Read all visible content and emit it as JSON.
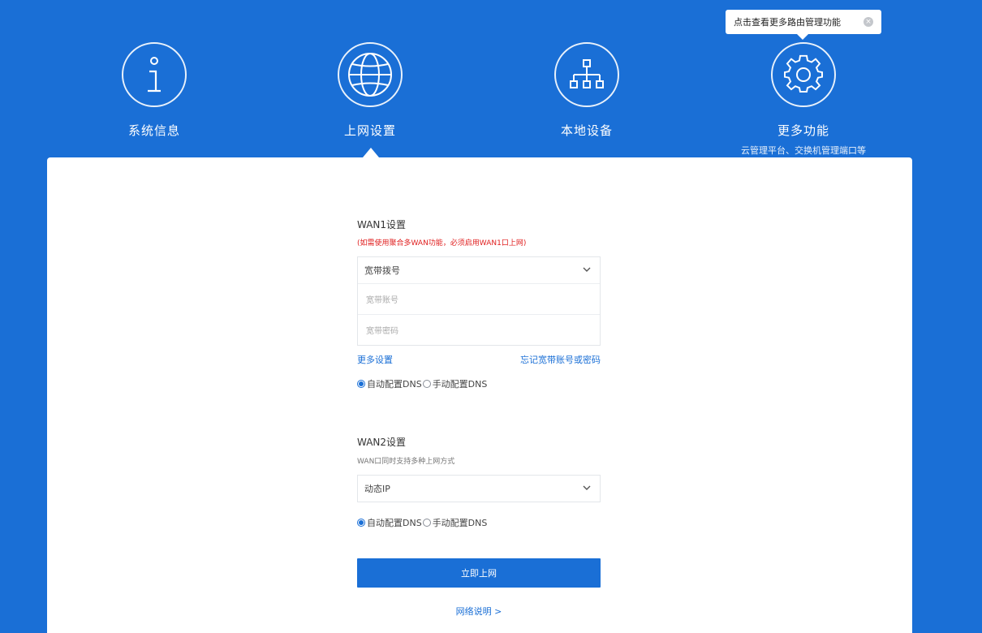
{
  "colors": {
    "brand": "#1a6fd6",
    "warning": "#e02020"
  },
  "nav": [
    {
      "id": "system-info",
      "label": "系统信息",
      "icon": "info-icon"
    },
    {
      "id": "internet-settings",
      "label": "上网设置",
      "icon": "globe-icon",
      "active": true
    },
    {
      "id": "local-devices",
      "label": "本地设备",
      "icon": "network-tree-icon"
    },
    {
      "id": "more-features",
      "label": "更多功能",
      "icon": "gear-icon",
      "sublabel": "云管理平台、交换机管理端口等"
    }
  ],
  "tooltip": {
    "text": "点击查看更多路由管理功能",
    "close_icon": "close-icon"
  },
  "wan1": {
    "title": "WAN1设置",
    "warning": "(如需使用聚合多WAN功能，必须启用WAN1口上网)",
    "mode": "宽带拨号",
    "account_placeholder": "宽带账号",
    "password_placeholder": "宽带密码",
    "more_settings": "更多设置",
    "forgot_link": "忘记宽带账号或密码",
    "dns_auto": "自动配置DNS",
    "dns_manual": "手动配置DNS"
  },
  "wan2": {
    "title": "WAN2设置",
    "hint": "WAN口同时支持多种上网方式",
    "mode": "动态IP",
    "dns_auto": "自动配置DNS",
    "dns_manual": "手动配置DNS"
  },
  "submit_label": "立即上网",
  "help_link": "网络说明 >"
}
